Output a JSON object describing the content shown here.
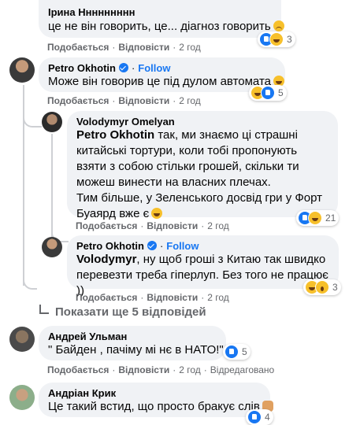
{
  "actions": {
    "like": "Подобається",
    "reply": "Відповісти"
  },
  "comments": [
    {
      "author": "Ірина Ннннннннн",
      "text": "це не він говорить, це... діагноз говорить",
      "time": "2 год",
      "reactions": {
        "count": "3",
        "types": [
          "like",
          "sad"
        ]
      }
    },
    {
      "author": "Petro Okhotin",
      "follow": "Follow",
      "text": "Може він говорив це під дулом автомата",
      "time": "2 год",
      "reactions": {
        "count": "5",
        "types": [
          "haha",
          "like"
        ]
      }
    },
    {
      "author": "Volodymyr Omelyan",
      "mention": "Petro Okhotin",
      "text": " так, ми знаємо ці страшні китайські тортури, коли тобі пропонують взяти з собою стільки грошей, скільки ти можеш винести на власних плечах.",
      "text2": "Тим більше, у Зеленського досвід гри у Форт Буаярд вже є",
      "time": "2 год",
      "reactions": {
        "count": "21",
        "types": [
          "like",
          "haha"
        ]
      }
    },
    {
      "author": "Petro Okhotin",
      "follow": "Follow",
      "mention": "Volodymyr",
      "text": ", ну щоб гроші з Китаю так швидко перевезти треба гіперлуп. Без того не працює ))",
      "time": "2 год",
      "reactions": {
        "count": "3",
        "types": [
          "haha",
          "wow"
        ]
      }
    },
    {
      "author": "Андрей Ульман",
      "text": "\" Байден , пачіму мі нє в НАТО!\"...",
      "time": "2 год",
      "edited": "Відредаговано",
      "reactions": {
        "count": "5",
        "types": [
          "like"
        ]
      }
    },
    {
      "author": "Андріан Крик",
      "text": "Це такий встид, що просто бракує слів",
      "time": "2 год",
      "reactions": {
        "count": "4",
        "types": [
          "like"
        ]
      }
    }
  ],
  "more_replies": "Показати ще 5 відповідей",
  "colors": {
    "bubble": "#f0f2f5",
    "link": "#1877f2",
    "meta": "#65676b"
  }
}
